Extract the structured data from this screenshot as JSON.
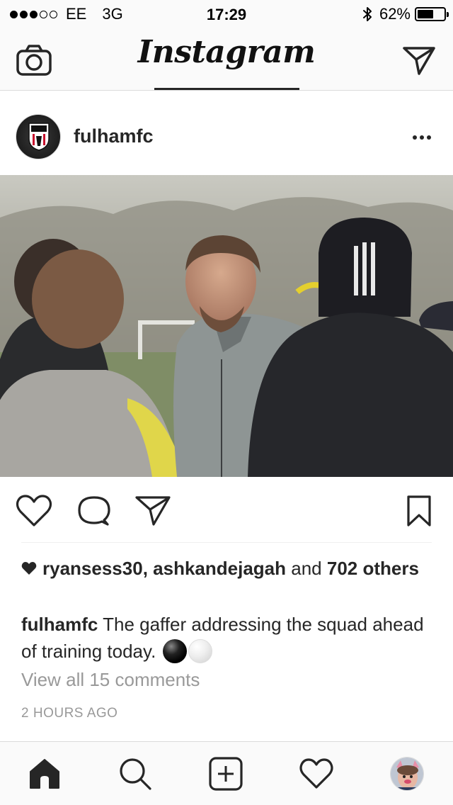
{
  "status_bar": {
    "signal_dots_filled": 3,
    "signal_dots_total": 5,
    "carrier": "EE",
    "network": "3G",
    "time": "17:29",
    "bluetooth_icon": "bluetooth-icon",
    "battery_percent_label": "62%",
    "battery_level": 0.62
  },
  "nav": {
    "logo_text": "Instagram",
    "left_icon": "camera-icon",
    "right_icon": "direct-message-icon"
  },
  "post": {
    "username": "fulhamfc",
    "avatar_icon": "fulham-crest",
    "more_icon": "more-dots-icon",
    "photo_description_icon": "photo",
    "actions": {
      "like_icon": "heart-icon",
      "comment_icon": "comment-icon",
      "share_icon": "share-icon",
      "save_icon": "bookmark-icon"
    },
    "likes": {
      "user1": "ryansess30",
      "separator": ",",
      "user2": "ashkandejagah",
      "and_text": "and",
      "others": "702 others"
    },
    "caption": {
      "username": "fulhamfc",
      "text": "The gaffer addressing the squad ahead of training today."
    },
    "view_comments": "View all 15 comments",
    "timestamp": "2 HOURS AGO"
  },
  "tab_bar": {
    "items": [
      {
        "icon": "home-icon"
      },
      {
        "icon": "search-icon"
      },
      {
        "icon": "add-post-icon"
      },
      {
        "icon": "activity-heart-icon"
      },
      {
        "icon": "profile-avatar"
      }
    ]
  },
  "colors": {
    "text_primary": "#262626",
    "text_secondary": "#999999",
    "bar_background": "#fafafa",
    "divider": "#dbdbdb"
  }
}
